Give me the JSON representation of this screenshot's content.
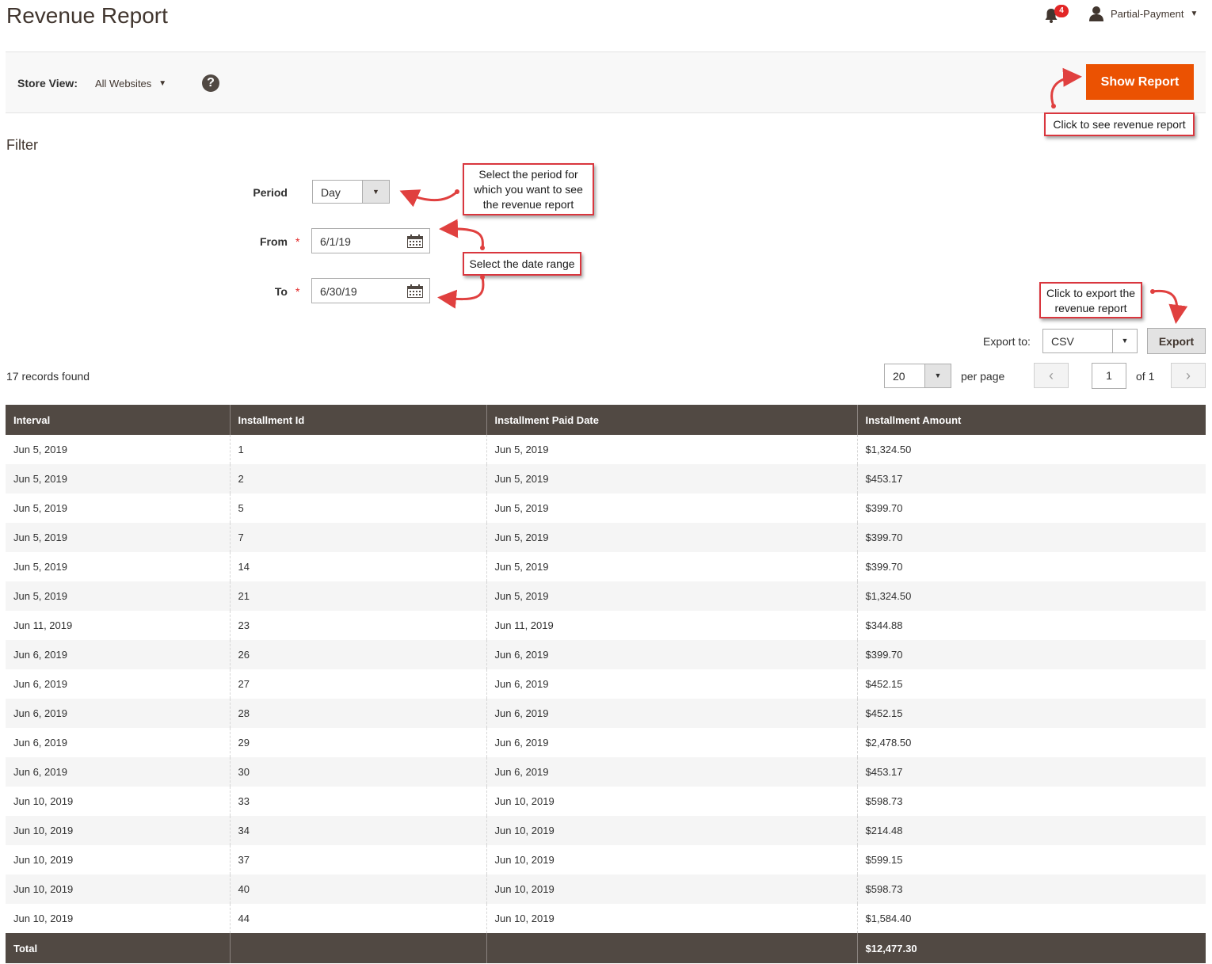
{
  "header": {
    "title": "Revenue Report",
    "notification_count": "4",
    "user_name": "Partial-Payment"
  },
  "store_view": {
    "label": "Store View:",
    "value": "All Websites",
    "help": "?"
  },
  "actions": {
    "show_report": "Show Report"
  },
  "callouts": {
    "show_report": "Click to see revenue report",
    "period_line1": "Select the period for",
    "period_line2": "which you want to see",
    "period_line3": "the revenue report",
    "date_range": "Select the date range",
    "export_line1": "Click to export the",
    "export_line2": "revenue report"
  },
  "filter": {
    "title": "Filter",
    "period_label": "Period",
    "period_value": "Day",
    "from_label": "From",
    "from_value": "6/1/19",
    "to_label": "To",
    "to_value": "6/30/19",
    "required_mark": "*"
  },
  "export": {
    "label": "Export to:",
    "format": "CSV",
    "button": "Export"
  },
  "pager": {
    "records_found": "17 records found",
    "per_page_value": "20",
    "per_page_label": "per page",
    "current_page": "1",
    "of_pages": "of 1"
  },
  "colors": {
    "accent": "#eb5202",
    "table_header": "#514943",
    "callout_border": "#d9363e"
  },
  "table": {
    "columns": [
      "Interval",
      "Installment Id",
      "Installment Paid Date",
      "Installment Amount"
    ],
    "rows": [
      [
        "Jun 5, 2019",
        "1",
        "Jun 5, 2019",
        "$1,324.50"
      ],
      [
        "Jun 5, 2019",
        "2",
        "Jun 5, 2019",
        "$453.17"
      ],
      [
        "Jun 5, 2019",
        "5",
        "Jun 5, 2019",
        "$399.70"
      ],
      [
        "Jun 5, 2019",
        "7",
        "Jun 5, 2019",
        "$399.70"
      ],
      [
        "Jun 5, 2019",
        "14",
        "Jun 5, 2019",
        "$399.70"
      ],
      [
        "Jun 5, 2019",
        "21",
        "Jun 5, 2019",
        "$1,324.50"
      ],
      [
        "Jun 11, 2019",
        "23",
        "Jun 11, 2019",
        "$344.88"
      ],
      [
        "Jun 6, 2019",
        "26",
        "Jun 6, 2019",
        "$399.70"
      ],
      [
        "Jun 6, 2019",
        "27",
        "Jun 6, 2019",
        "$452.15"
      ],
      [
        "Jun 6, 2019",
        "28",
        "Jun 6, 2019",
        "$452.15"
      ],
      [
        "Jun 6, 2019",
        "29",
        "Jun 6, 2019",
        "$2,478.50"
      ],
      [
        "Jun 6, 2019",
        "30",
        "Jun 6, 2019",
        "$453.17"
      ],
      [
        "Jun 10, 2019",
        "33",
        "Jun 10, 2019",
        "$598.73"
      ],
      [
        "Jun 10, 2019",
        "34",
        "Jun 10, 2019",
        "$214.48"
      ],
      [
        "Jun 10, 2019",
        "37",
        "Jun 10, 2019",
        "$599.15"
      ],
      [
        "Jun 10, 2019",
        "40",
        "Jun 10, 2019",
        "$598.73"
      ],
      [
        "Jun 10, 2019",
        "44",
        "Jun 10, 2019",
        "$1,584.40"
      ]
    ],
    "total_label": "Total",
    "total_amount": "$12,477.30"
  }
}
